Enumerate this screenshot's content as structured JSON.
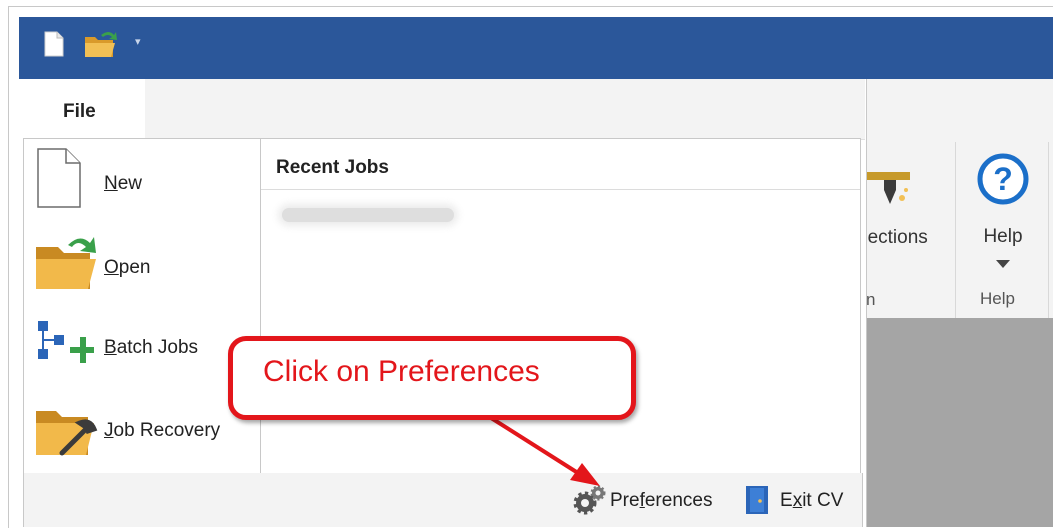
{
  "quick_access": {
    "icons": [
      "new-document-icon",
      "open-folder-icon",
      "customize-dropdown-icon"
    ],
    "customize_glyph": "▾"
  },
  "backstage": {
    "file_tab": "File",
    "menu": [
      {
        "label": "New",
        "icon": "new-document-icon"
      },
      {
        "label": "Open",
        "icon": "open-folder-icon"
      },
      {
        "label": "Batch Jobs",
        "icon": "batch-jobs-icon"
      },
      {
        "label": "Job Recovery",
        "icon": "job-recovery-icon"
      }
    ],
    "recent_jobs_header": "Recent Jobs",
    "bottom": {
      "preferences": "Preferences",
      "exit": "Exit CV"
    }
  },
  "ribbon": {
    "connections_label": "nections",
    "group_label_partial": "n",
    "help_label": "Help",
    "help_group": "Help",
    "help_glyph": "?"
  },
  "callout": {
    "text": "Click on Preferences"
  },
  "colors": {
    "title_bar": "#2b579a",
    "callout": "#e3161b",
    "help_icon": "#1b6fc9"
  }
}
